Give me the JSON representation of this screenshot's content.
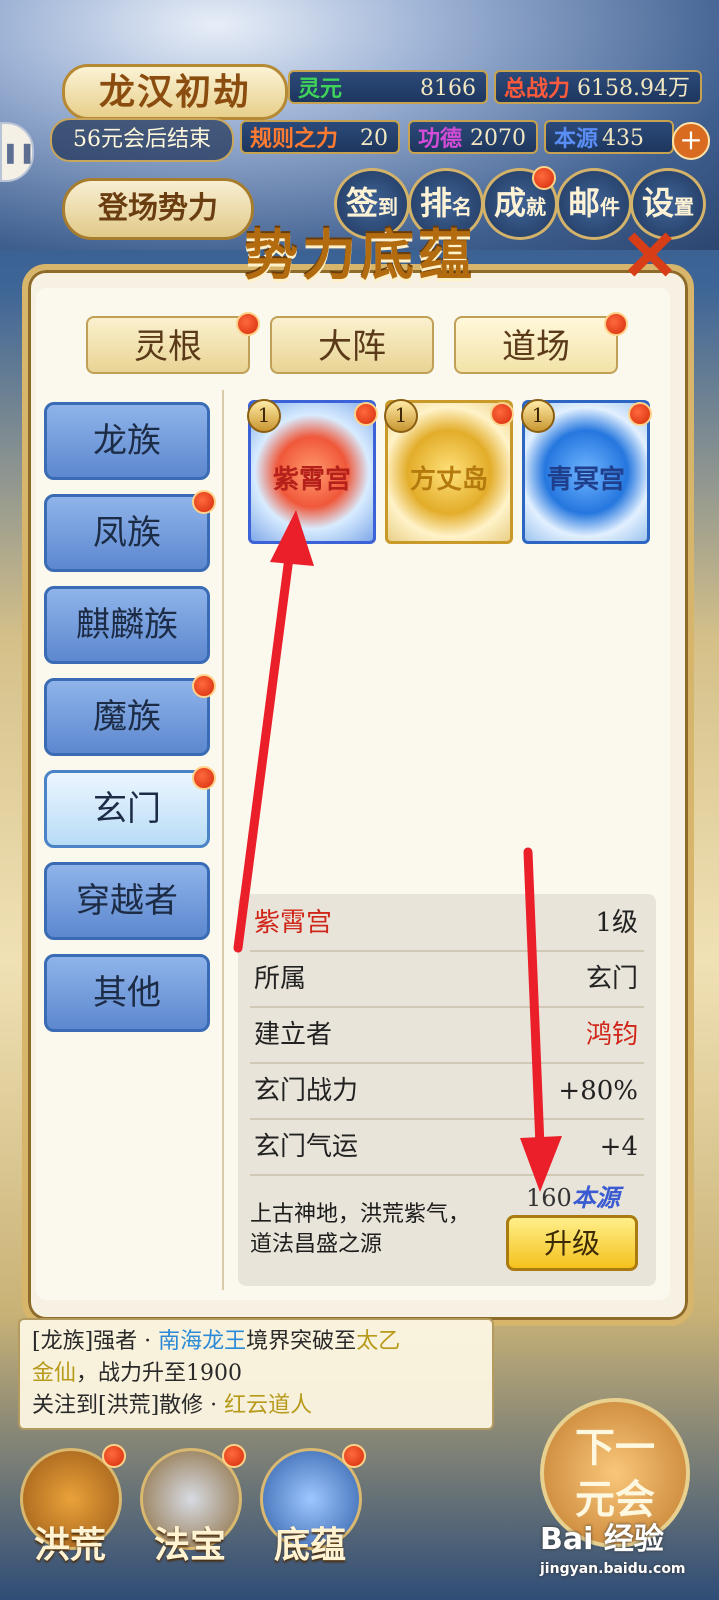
{
  "hud": {
    "era_title": "龙汉初劫",
    "era_countdown": "56元会后结束",
    "faction_button": "登场势力",
    "stats": [
      {
        "label": "灵元",
        "value": "8166",
        "label_color": "#3fd35a"
      },
      {
        "label": "总战力",
        "value": "6158.94万",
        "label_color": "#ff5a3c"
      },
      {
        "label": "规则之力",
        "value": "20",
        "label_color": "#ff7b31"
      },
      {
        "label": "功德",
        "value": "2070",
        "label_color": "#d24cd8"
      },
      {
        "label": "本源",
        "value": "435",
        "label_color": "#5b8ef5"
      }
    ],
    "add_symbol": "+",
    "pause_symbol": "❚❚",
    "menu": [
      {
        "big": "签",
        "small": "到"
      },
      {
        "big": "排",
        "small": "名"
      },
      {
        "big": "成",
        "small": "就"
      },
      {
        "big": "邮",
        "small": "件"
      },
      {
        "big": "设",
        "small": "置"
      }
    ]
  },
  "panel": {
    "title": "势力底蕴",
    "close_symbol": "✕",
    "tabs": [
      "灵根",
      "大阵",
      "道场"
    ],
    "active_tab": "道场",
    "sidebar": [
      "龙族",
      "凤族",
      "麒麟族",
      "魔族",
      "玄门",
      "穿越者",
      "其他"
    ],
    "selected_sidebar": "玄门",
    "cards": [
      {
        "name": "紫霄宫",
        "level": "1",
        "color": "#e8452a"
      },
      {
        "name": "方丈岛",
        "level": "1",
        "color": "#d8a21c"
      },
      {
        "name": "青冥宫",
        "level": "1",
        "color": "#2f7ee0"
      }
    ],
    "detail": {
      "name": "紫霄宫",
      "level": "1级",
      "rows": [
        {
          "key": "所属",
          "value": "玄门"
        },
        {
          "key": "建立者",
          "value": "鸿钧"
        },
        {
          "key": "玄门战力",
          "value": "+80%"
        },
        {
          "key": "玄门气运",
          "value": "+4"
        }
      ],
      "description_1": "上古神地，洪荒紫气，",
      "description_2": "道法昌盛之源",
      "cost_amount": "160",
      "cost_unit": "本源",
      "upgrade_label": "升级"
    }
  },
  "log": {
    "line1_a": "[龙族]强者 · ",
    "line1_b": "南海龙王",
    "line1_c": "境界突破至",
    "line1_d": "太乙",
    "line2_a": "金仙",
    "line2_b": "，战力升至1900",
    "line3_a": "关注到[洪荒]散修 · ",
    "line3_b": "红云道人"
  },
  "bottom": {
    "buttons": [
      "洪荒",
      "法宝",
      "底蕴"
    ],
    "next_label_1": "下一",
    "next_label_2": "元会"
  },
  "watermark": {
    "brand": "Bai 经验",
    "url": "jingyan.baidu.com"
  }
}
